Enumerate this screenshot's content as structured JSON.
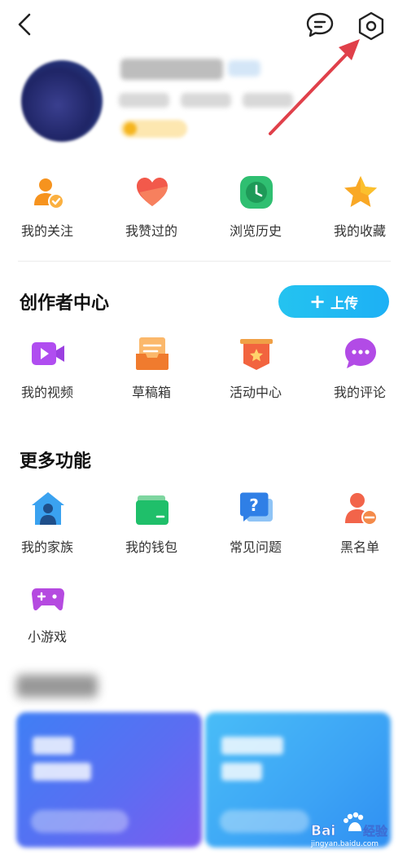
{
  "header": {
    "back_icon": "chevron-left-icon",
    "message_icon": "chat-bubble-icon",
    "settings_icon": "hexagon-settings-icon"
  },
  "quick_actions": [
    {
      "label": "我的关注",
      "icon": "person-follow-icon"
    },
    {
      "label": "我赞过的",
      "icon": "heart-icon"
    },
    {
      "label": "浏览历史",
      "icon": "clock-icon"
    },
    {
      "label": "我的收藏",
      "icon": "star-icon"
    }
  ],
  "creator": {
    "title": "创作者中心",
    "upload_label": "上传",
    "items": [
      {
        "label": "我的视频",
        "icon": "video-camera-icon"
      },
      {
        "label": "草稿箱",
        "icon": "draft-box-icon"
      },
      {
        "label": "活动中心",
        "icon": "badge-star-icon"
      },
      {
        "label": "我的评论",
        "icon": "comment-bubble-icon"
      }
    ]
  },
  "more": {
    "title": "更多功能",
    "items": [
      {
        "label": "我的家族",
        "icon": "house-person-icon"
      },
      {
        "label": "我的钱包",
        "icon": "wallet-icon"
      },
      {
        "label": "常见问题",
        "icon": "question-bubble-icon"
      },
      {
        "label": "黑名单",
        "icon": "person-block-icon"
      },
      {
        "label": "小游戏",
        "icon": "gamepad-icon"
      }
    ]
  },
  "colors": {
    "accent": "#1db0f5",
    "annotation_arrow": "#e0404a"
  }
}
